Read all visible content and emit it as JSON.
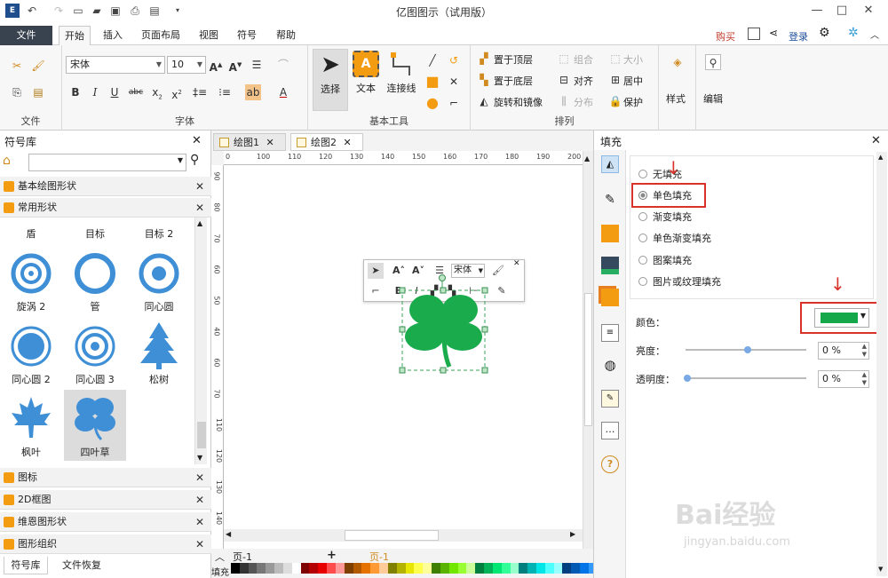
{
  "window": {
    "title": "亿图图示（试用版）"
  },
  "menu": {
    "file": "文件",
    "tabs": [
      "开始",
      "插入",
      "页面布局",
      "视图",
      "符号",
      "帮助"
    ],
    "buy": "购买",
    "login": "登录"
  },
  "ribbon": {
    "font_name": "宋体",
    "font_size": "10",
    "groups": {
      "file": "文件",
      "font": "字体",
      "basic_tools": "基本工具",
      "arrange": "排列"
    },
    "tools": {
      "select": "选择",
      "text": "文本",
      "connector": "连接线"
    },
    "arrange": {
      "bring_front": "置于顶层",
      "send_back": "置于底层",
      "rotate_mirror": "旋转和镜像",
      "group": "组合",
      "size": "大小",
      "align": "对齐",
      "center": "居中",
      "distribute": "分布",
      "protect": "保护"
    },
    "style": "样式",
    "edit": "编辑"
  },
  "left_panel": {
    "title": "符号库",
    "search_placeholder": "",
    "categories_top": [
      "基本绘图形状",
      "常用形状"
    ],
    "row0_labels": [
      "盾",
      "目标",
      "目标 2"
    ],
    "shapes": [
      {
        "label": "旋涡 2"
      },
      {
        "label": "管"
      },
      {
        "label": "同心圆"
      },
      {
        "label": "同心圆 2"
      },
      {
        "label": "同心圆 3"
      },
      {
        "label": "松树"
      },
      {
        "label": "枫叶"
      },
      {
        "label": "四叶草"
      }
    ],
    "categories_bottom": [
      "图标",
      "2D框图",
      "维恩图形状",
      "图形组织"
    ],
    "bottom_tabs": [
      "符号库",
      "文件恢复"
    ]
  },
  "canvas": {
    "tabs": [
      "绘图1",
      "绘图2"
    ],
    "active_tab": 1,
    "ruler_h": [
      "0",
      "100",
      "110",
      "120",
      "130",
      "140",
      "150",
      "160",
      "170",
      "180",
      "190",
      "200"
    ],
    "ruler_v": [
      "90",
      "80",
      "70",
      "60",
      "50",
      "40",
      "60",
      "70",
      "110",
      "120",
      "130",
      "140"
    ],
    "page_label": "页-1",
    "page_tab": "页-1",
    "fill_label": "填充",
    "shape_color": "#1aab4c",
    "float_font": "宋体"
  },
  "right_panel": {
    "title": "填充",
    "options": [
      "无填充",
      "单色填充",
      "渐变填充",
      "单色渐变填充",
      "图案填充",
      "图片或纹理填充"
    ],
    "selected_option": 1,
    "color_label": "颜色：",
    "color_value": "#14a84a",
    "brightness_label": "亮度：",
    "brightness_value": "0 %",
    "transparency_label": "透明度：",
    "transparency_value": "0 %"
  },
  "watermark": {
    "text": "Bai经验",
    "url": "jingyan.baidu.com"
  }
}
